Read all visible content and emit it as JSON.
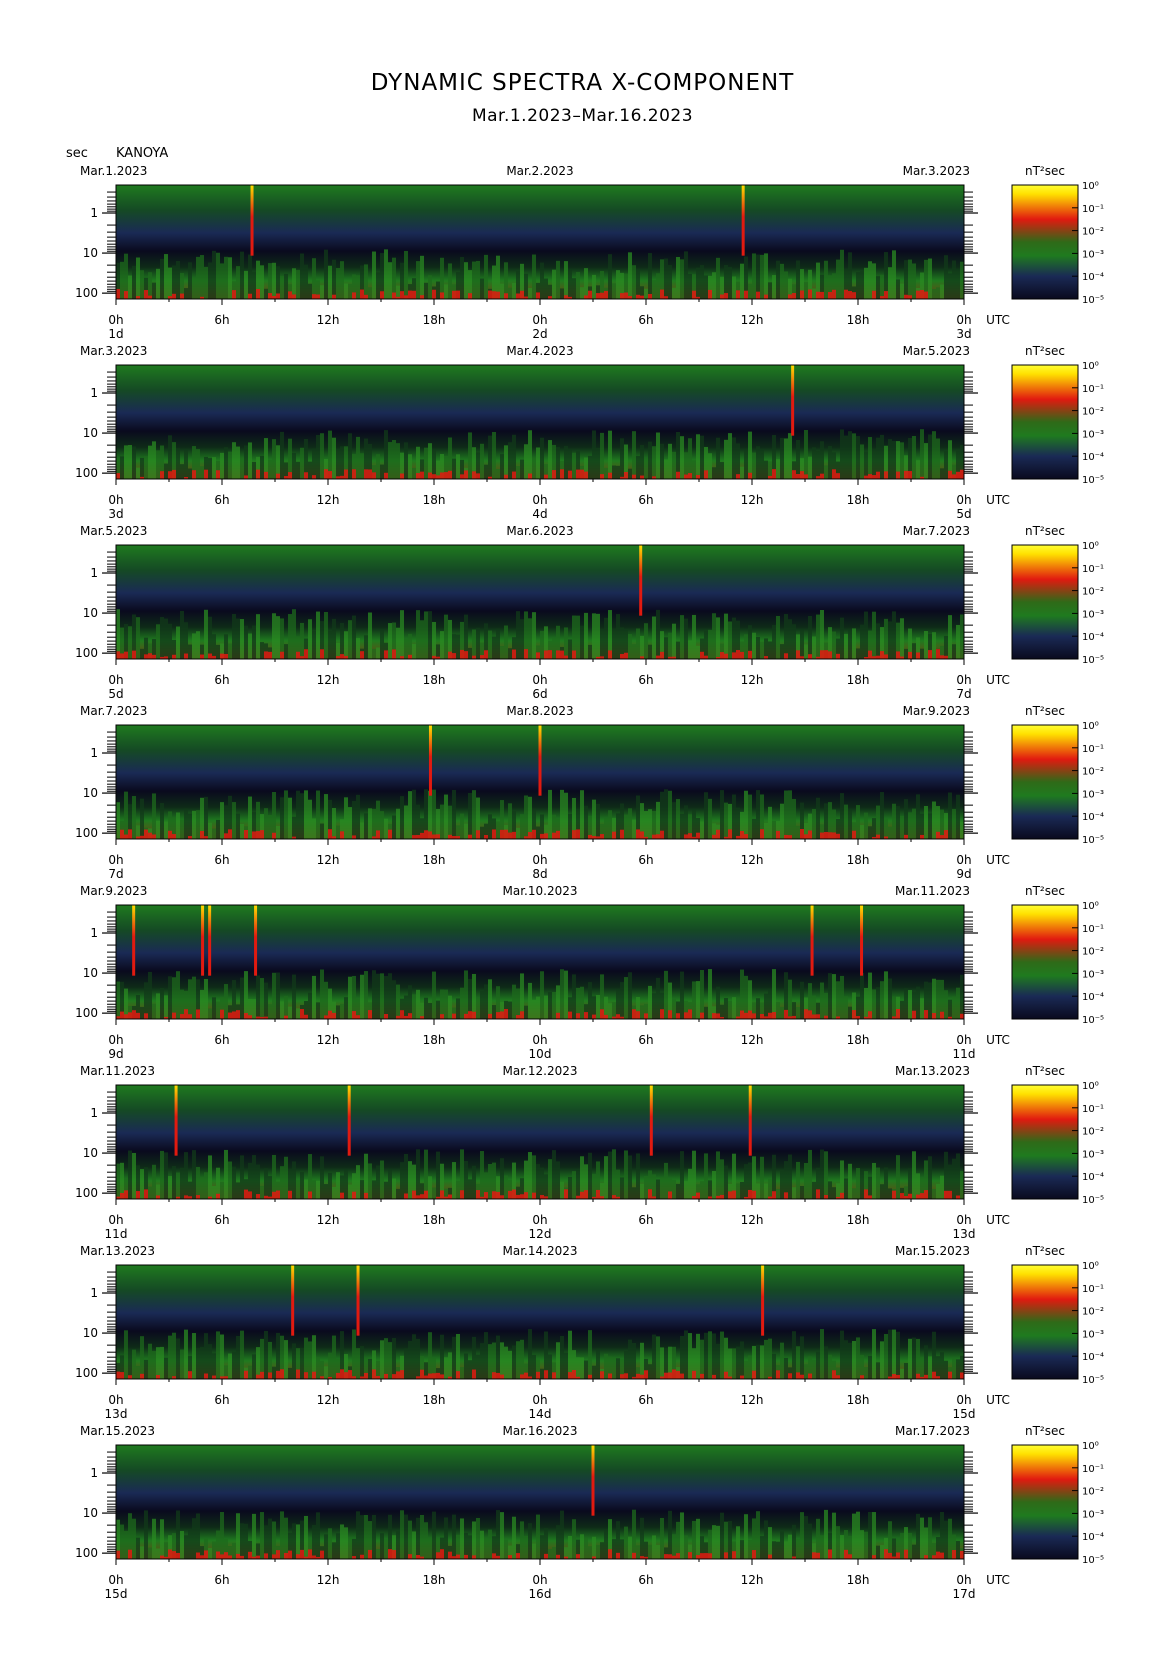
{
  "header": {
    "title": "DYNAMIC SPECTRA X-COMPONENT",
    "subtitle": "Mar.1.2023–Mar.16.2023",
    "y_unit": "sec",
    "station": "KANOYA"
  },
  "colors": {
    "low": "#0a0a1e",
    "navy": "#1a2a55",
    "green": "#1f7a1f",
    "red": "#e11a10",
    "yellow": "#ffe000",
    "colorbar_top": "#ffff33"
  },
  "chart_data": {
    "type": "heatmap",
    "y_axis": {
      "label": "sec",
      "scale": "log",
      "ticks": [
        "1",
        "10",
        "100"
      ]
    },
    "x_axis": {
      "unit": "UTC",
      "ticks": [
        "0h",
        "6h",
        "12h",
        "18h",
        "0h",
        "6h",
        "12h",
        "18h",
        "0h"
      ]
    },
    "colorbar": {
      "unit": "nT²sec",
      "ticks": [
        "10⁰",
        "10⁻¹",
        "10⁻²",
        "10⁻³",
        "10⁻⁴",
        "10⁻⁵"
      ]
    },
    "panels": [
      {
        "left_date": "Mar.1.2023",
        "mid_date": "Mar.2.2023",
        "right_date": "Mar.3.2023",
        "day_labels": [
          "1d",
          "2d",
          "3d"
        ],
        "spikes_hours": [
          7.7,
          35.5
        ]
      },
      {
        "left_date": "Mar.3.2023",
        "mid_date": "Mar.4.2023",
        "right_date": "Mar.5.2023",
        "day_labels": [
          "3d",
          "4d",
          "5d"
        ],
        "spikes_hours": [
          38.3
        ]
      },
      {
        "left_date": "Mar.5.2023",
        "mid_date": "Mar.6.2023",
        "right_date": "Mar.7.2023",
        "day_labels": [
          "5d",
          "6d",
          "7d"
        ],
        "spikes_hours": [
          29.7
        ]
      },
      {
        "left_date": "Mar.7.2023",
        "mid_date": "Mar.8.2023",
        "right_date": "Mar.9.2023",
        "day_labels": [
          "7d",
          "8d",
          "9d"
        ],
        "spikes_hours": [
          17.8,
          24.0
        ]
      },
      {
        "left_date": "Mar.9.2023",
        "mid_date": "Mar.10.2023",
        "right_date": "Mar.11.2023",
        "day_labels": [
          "9d",
          "10d",
          "11d"
        ],
        "spikes_hours": [
          1.0,
          4.9,
          5.3,
          7.9,
          39.4,
          42.2
        ]
      },
      {
        "left_date": "Mar.11.2023",
        "mid_date": "Mar.12.2023",
        "right_date": "Mar.13.2023",
        "day_labels": [
          "11d",
          "12d",
          "13d"
        ],
        "spikes_hours": [
          3.4,
          13.2,
          30.3,
          35.9
        ]
      },
      {
        "left_date": "Mar.13.2023",
        "mid_date": "Mar.14.2023",
        "right_date": "Mar.15.2023",
        "day_labels": [
          "13d",
          "14d",
          "15d"
        ],
        "spikes_hours": [
          10.0,
          13.7,
          36.6
        ]
      },
      {
        "left_date": "Mar.15.2023",
        "mid_date": "Mar.16.2023",
        "right_date": "Mar.17.2023",
        "day_labels": [
          "15d",
          "16d",
          "17d"
        ],
        "spikes_hours": [
          27.0
        ]
      }
    ]
  }
}
